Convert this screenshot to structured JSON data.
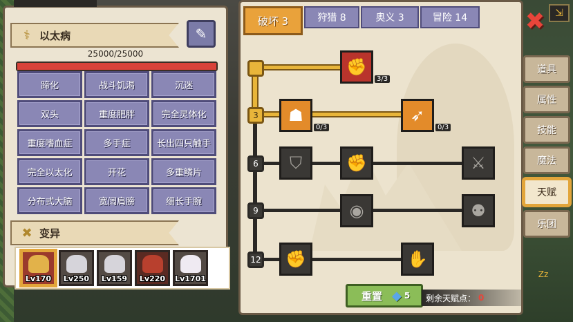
{
  "left_panel": {
    "title": "以太病",
    "title_icon": "dna-icon",
    "hp_text": "25000/25000",
    "hp_fraction": 1.0,
    "syringe_icon": "syringe-icon",
    "traits": [
      "蹄化",
      "战斗饥渴",
      "沉迷",
      "双头",
      "重度肥胖",
      "完全灵体化",
      "重度嗜血症",
      "多手症",
      "长出四只触手",
      "完全以太化",
      "开花",
      "多重鳞片",
      "分布式大脑",
      "宽阔肩膀",
      "细长手腕"
    ],
    "mutation_title": "变异",
    "heroes": [
      {
        "level": "Lv170",
        "selected": true
      },
      {
        "level": "Lv250",
        "selected": false
      },
      {
        "level": "Lv159",
        "selected": false
      },
      {
        "level": "Lv220",
        "selected": false
      },
      {
        "level": "Lv1701",
        "selected": false
      }
    ]
  },
  "tabs": [
    {
      "label": "破坏 3",
      "active": true
    },
    {
      "label": "狩猎 8",
      "active": false
    },
    {
      "label": "奥义 3",
      "active": false
    },
    {
      "label": "冒险 14",
      "active": false
    }
  ],
  "tree": {
    "levels": [
      "3",
      "6",
      "9",
      "12"
    ],
    "talents": [
      {
        "icon": "arm-wrestle-icon",
        "count": "3/3",
        "state": "maxed"
      },
      {
        "icon": "muscle-body-icon",
        "count": "0/3",
        "state": "available"
      },
      {
        "icon": "arrow-shot-icon",
        "count": "0/3",
        "state": "available"
      },
      {
        "icon": "shield-swap-icon",
        "state": "locked"
      },
      {
        "icon": "fist-punch-icon",
        "state": "locked"
      },
      {
        "icon": "sword-slash-icon",
        "state": "locked"
      },
      {
        "icon": "ripple-icon",
        "state": "locked"
      },
      {
        "icon": "bat-wings-icon",
        "state": "locked"
      },
      {
        "icon": "raised-fist-icon",
        "state": "locked"
      },
      {
        "icon": "gauntlet-icon",
        "state": "locked"
      }
    ]
  },
  "reset": {
    "label": "重置",
    "gem_count": "5"
  },
  "points": {
    "label": "剩余天赋点：",
    "value": "0"
  },
  "side_tabs": [
    "道具",
    "属性",
    "技能",
    "魔法",
    "天赋",
    "乐团"
  ],
  "active_side_tab": "天赋",
  "colors": {
    "accent": "#e9a23b",
    "trait_bg": "#8a87b5",
    "hp": "#d9423a",
    "reset": "#8bbd58"
  }
}
